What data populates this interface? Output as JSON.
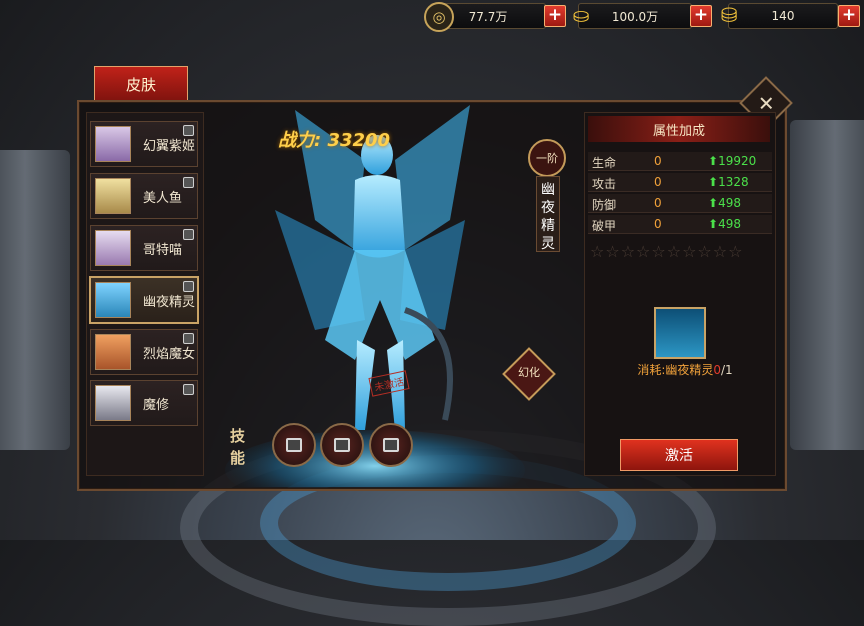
{
  "currency": [
    {
      "icon": "coin-icon",
      "value": "77.7万"
    },
    {
      "icon": "gold-ingot-icon",
      "value": "100.0万"
    },
    {
      "icon": "bound-gold-icon",
      "value": "140"
    }
  ],
  "tab_label": "皮肤",
  "skins": [
    {
      "name": "幻翼紫姬",
      "locked": true,
      "color": "#8a6aa8"
    },
    {
      "name": "美人鱼",
      "locked": true,
      "color": "#a88a4a"
    },
    {
      "name": "哥特喵",
      "locked": true,
      "color": "#9a7ab0"
    },
    {
      "name": "幽夜精灵",
      "locked": true,
      "selected": true,
      "color": "#2a86b8"
    },
    {
      "name": "烈焰魔女",
      "locked": true,
      "color": "#a8542a"
    },
    {
      "name": "魔修",
      "locked": true,
      "color": "#7a7a88"
    }
  ],
  "power_text": "战力: 33200",
  "grade": "一阶",
  "selected_name": "幽夜精灵",
  "stamp_text": "未激活",
  "transform_button": "幻化",
  "skill_title": "技能",
  "attributes": {
    "title": "属性加成",
    "rows": [
      {
        "key": "生命",
        "value": "0",
        "add": "19920"
      },
      {
        "key": "攻击",
        "value": "0",
        "add": "1328"
      },
      {
        "key": "防御",
        "value": "0",
        "add": "498"
      },
      {
        "key": "破甲",
        "value": "0",
        "add": "498"
      }
    ],
    "stars": 10
  },
  "consume": {
    "label": "消耗:幽夜精灵",
    "have": "0",
    "need": "/1"
  },
  "activate_button": "激活",
  "colors": {
    "accent_red": "#c02219",
    "gold": "#ffcf4a",
    "green": "#4be04a",
    "orange": "#f0a13a"
  }
}
